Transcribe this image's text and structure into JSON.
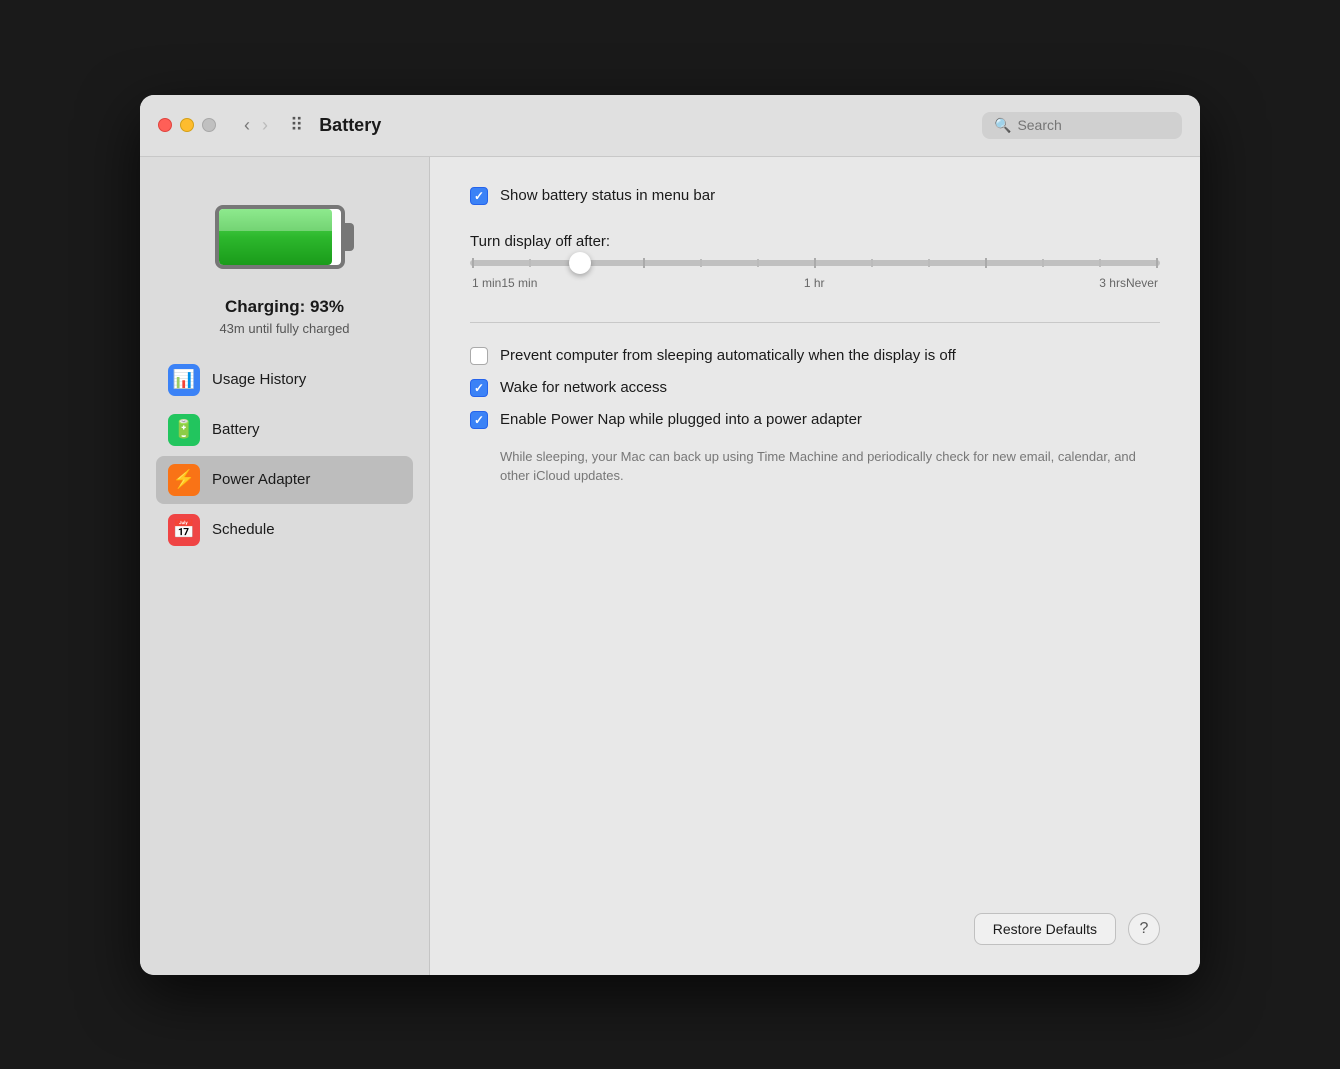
{
  "window": {
    "title": "Battery"
  },
  "titlebar": {
    "title": "Battery",
    "search_placeholder": "Search"
  },
  "sidebar": {
    "battery_status": "Charging: 93%",
    "battery_sub": "43m until fully charged",
    "items": [
      {
        "id": "usage-history",
        "label": "Usage History",
        "icon": "📊",
        "icon_class": "icon-blue",
        "active": false
      },
      {
        "id": "battery",
        "label": "Battery",
        "icon": "🔋",
        "icon_class": "icon-green",
        "active": false
      },
      {
        "id": "power-adapter",
        "label": "Power Adapter",
        "icon": "⚡",
        "icon_class": "icon-orange",
        "active": true
      },
      {
        "id": "schedule",
        "label": "Schedule",
        "icon": "📅",
        "icon_class": "icon-red",
        "active": false
      }
    ]
  },
  "main": {
    "show_battery_status_label": "Show battery status in menu bar",
    "show_battery_status_checked": true,
    "turn_display_off_label": "Turn display off after:",
    "slider": {
      "ticks": [
        "1 min",
        "15 min",
        "1 hr",
        "3 hrs",
        "Never"
      ]
    },
    "prevent_sleep_label": "Prevent computer from sleeping automatically when the display is off",
    "prevent_sleep_checked": false,
    "wake_network_label": "Wake for network access",
    "wake_network_checked": true,
    "power_nap_label": "Enable Power Nap while plugged into a power adapter",
    "power_nap_checked": true,
    "power_nap_description": "While sleeping, your Mac can back up using Time Machine and periodically check for new email, calendar, and other iCloud updates.",
    "restore_defaults_label": "Restore Defaults",
    "help_label": "?"
  }
}
